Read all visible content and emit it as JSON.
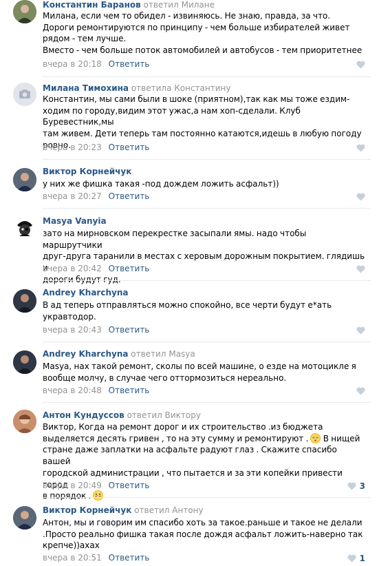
{
  "comments": [
    {
      "author": "Константин Баранов",
      "reply_to": "ответил Милане",
      "lines": [
        "Милана, если чем то обидел - извиняюсь. Не знаю, правда, за что.",
        "Дороги ремонтируются по принципу - чем больше избирателей живет",
        "рядом - тем лучше.",
        "Вместо - чем больше поток автомобилей и автобусов - тем приоритетнее"
      ],
      "date": "вчера в 20:18",
      "reply_label": "Ответить",
      "likes": "",
      "avatar_icon": "user-photo-icon",
      "avatar_color": "#6b7a52"
    },
    {
      "author": "Милана Тимохина",
      "reply_to": "ответила Константину",
      "lines": [
        "Константин, мы сами были в шоке (приятном),так как мы тоже ездим-",
        "ходим по городу,видим этот ужас,а нам хоп-сделали. Клуб Буревестник,мы",
        "там живем. Дети теперь там постоянно катаются,идешь в любую погоду",
        "ровно."
      ],
      "date": "вчера в 20:23",
      "reply_label": "Ответить",
      "likes": "",
      "avatar_icon": "camera-placeholder-icon",
      "avatar_color": "#dfe4ea"
    },
    {
      "author": "Виктор Корнейчук",
      "reply_to": "",
      "lines": [
        "у них же фишка такая -под дождем ложить асфальт))"
      ],
      "date": "вчера в 20:27",
      "reply_label": "Ответить",
      "likes": "",
      "avatar_icon": "user-photo-icon",
      "avatar_color": "#4a5a6a"
    },
    {
      "author": "Masya Vanyia",
      "reply_to": "",
      "lines": [
        "зато на мирновском перекрестке засыпали ямы. надо чтобы маршрутчики",
        "друг-друга таранили в местах с херовым дорожным покрытием. глядишь и",
        "дороги будут гуд."
      ],
      "date": "вчера в 20:42",
      "reply_label": "Ответить",
      "likes": "",
      "avatar_icon": "pirate-cat-icon",
      "avatar_color": "#ffffff"
    },
    {
      "author": "Andrey Kharchyna",
      "reply_to": "",
      "lines": [
        "В ад теперь отправляться можно спокойно, все черти будут е*ать",
        "укравтодор."
      ],
      "date": "вчера в 20:43",
      "reply_label": "Ответить",
      "likes": "",
      "avatar_icon": "user-photo-icon",
      "avatar_color": "#2c3340"
    },
    {
      "author": "Andrey Kharchyna",
      "reply_to": "ответил Masya",
      "lines": [
        "Masya, нах такой ремонт, сколы по всей машине, о езде на мотоцикле я",
        "вообще молчу, в случае чего оттормозиться нереально."
      ],
      "date": "вчера в 20:48",
      "reply_label": "Ответить",
      "likes": "",
      "avatar_icon": "user-photo-icon",
      "avatar_color": "#2c3340"
    },
    {
      "author": "Антон Кундуссов",
      "reply_to": "ответил Виктору",
      "lines": [
        "Виктор, Когда на ремонт дорог и их строительство .из бюджета",
        "выделяется десять гривен , то на эту сумму и ремонтируют .",
        "стране даже заплатки на асфальте радуют глаз . Скажите спасибо вашей",
        "городской администрации , что пытается и за эти копейки привести город",
        "в порядок ."
      ],
      "inline_text": "В нищей",
      "date": "вчера в 20:49",
      "reply_label": "Ответить",
      "likes": "3",
      "avatar_icon": "user-photo-icon",
      "avatar_color": "#b0705a"
    },
    {
      "author": "Виктор Корнейчук",
      "reply_to": "ответил Антону",
      "lines": [
        "Антон, мы и говорим им спасибо хоть за такое.раньше и такое не делали",
        ".Просто реально фишка такая после дождя асфальт ложить-наверно так",
        "крепче))ахах"
      ],
      "date": "вчера в 20:51",
      "reply_label": "Ответить",
      "likes": "1",
      "avatar_icon": "user-photo-icon",
      "avatar_color": "#4a5a6a"
    }
  ],
  "colors": {
    "link": "#2a5885",
    "muted": "#939393",
    "divider": "#e7e8ec",
    "like_icon": "#c5d0db"
  }
}
